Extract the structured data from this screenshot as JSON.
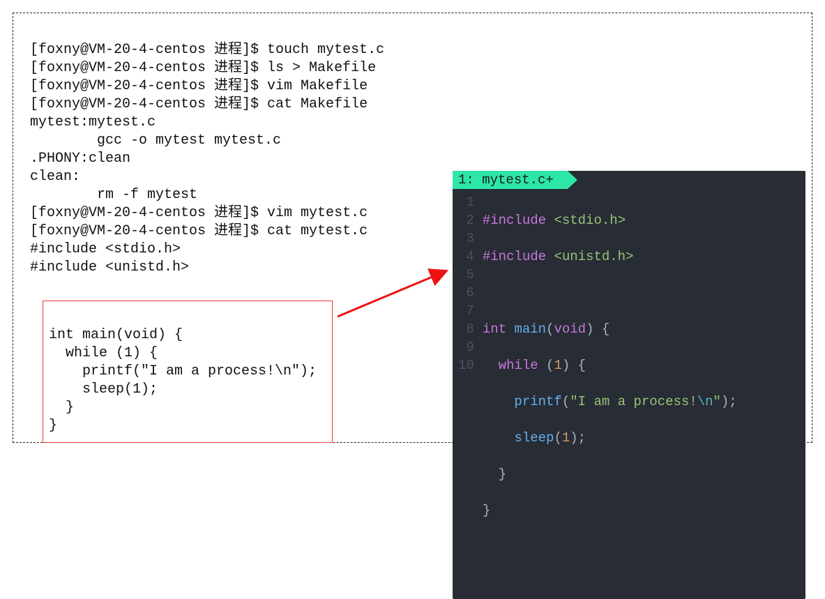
{
  "terminal": {
    "lines": [
      "[foxny@VM-20-4-centos 进程]$ touch mytest.c",
      "[foxny@VM-20-4-centos 进程]$ ls > Makefile",
      "[foxny@VM-20-4-centos 进程]$ vim Makefile",
      "[foxny@VM-20-4-centos 进程]$ cat Makefile",
      "mytest:mytest.c",
      "        gcc -o mytest mytest.c",
      ".PHONY:clean",
      "clean:",
      "        rm -f mytest",
      "[foxny@VM-20-4-centos 进程]$ vim mytest.c",
      "[foxny@VM-20-4-centos 进程]$ cat mytest.c",
      "#include <stdio.h>",
      "#include <unistd.h>"
    ]
  },
  "redbox": {
    "lines": [
      "int main(void) {",
      "  while (1) {",
      "    printf(\"I am a process!\\n\");",
      "    sleep(1);",
      "  }",
      "}"
    ]
  },
  "editor": {
    "tab": "1: mytest.c+",
    "linenos": [
      "1",
      "2",
      "3",
      "4",
      "5",
      "6",
      "7",
      "8",
      "9",
      "10"
    ],
    "code": {
      "l1_pp": "#include",
      "l1_hdr": "<stdio.h>",
      "l2_pp": "#include",
      "l2_hdr": "<unistd.h>",
      "l4_int": "int",
      "l4_main": "main",
      "l4_void": "void",
      "l5_while": "while",
      "l5_one": "1",
      "l6_printf": "printf",
      "l6_str_a": "\"I am a process!",
      "l6_esc": "\\n",
      "l6_str_b": "\"",
      "l7_sleep": "sleep",
      "l7_one": "1"
    }
  }
}
